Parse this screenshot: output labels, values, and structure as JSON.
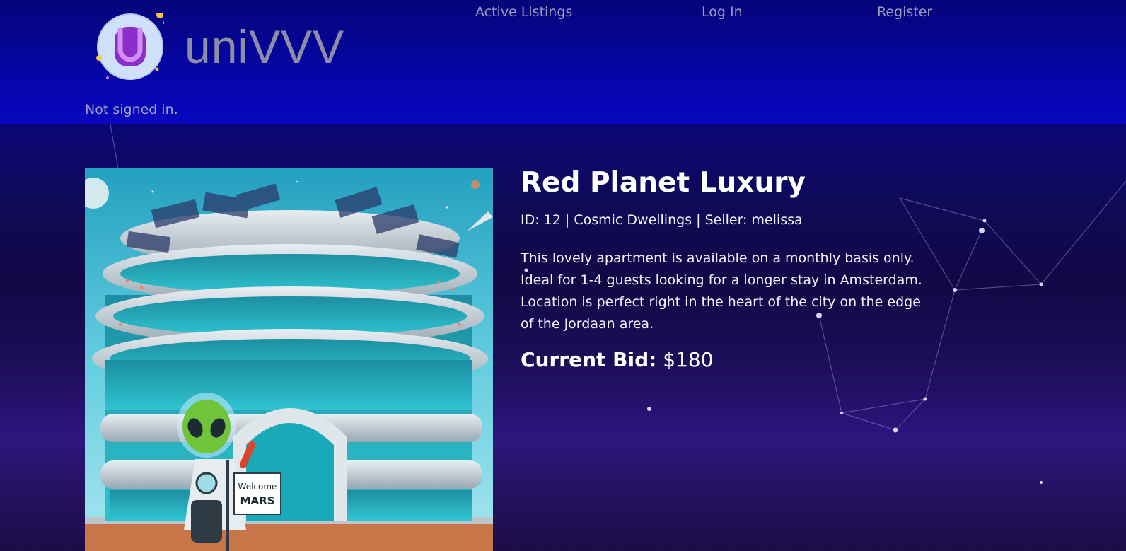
{
  "header": {
    "brand": "uniVVV",
    "logo_letter": "U",
    "nav": {
      "active_listings": "Active Listings",
      "log_in": "Log In",
      "register": "Register"
    },
    "auth_status": "Not signed in."
  },
  "listing": {
    "title": "Red Planet Luxury",
    "meta": "ID: 12 | Cosmic Dwellings | Seller: melissa",
    "description": "This lovely apartment is available on a monthly basis only. Ideal for 1-4 guests looking for a longer stay in Amsterdam. Location is perfect right in the heart of the city on the edge of the Jordaan area.",
    "bid_label": "Current Bid:",
    "bid_value": "$180",
    "image": {
      "sign_line1": "Welcome",
      "sign_line2": "MARS"
    }
  },
  "colors": {
    "header_bg": "#0505a8",
    "nav_text": "#9c9cbc",
    "brand_text": "#8d8da8",
    "body_text": "#ffffff"
  }
}
